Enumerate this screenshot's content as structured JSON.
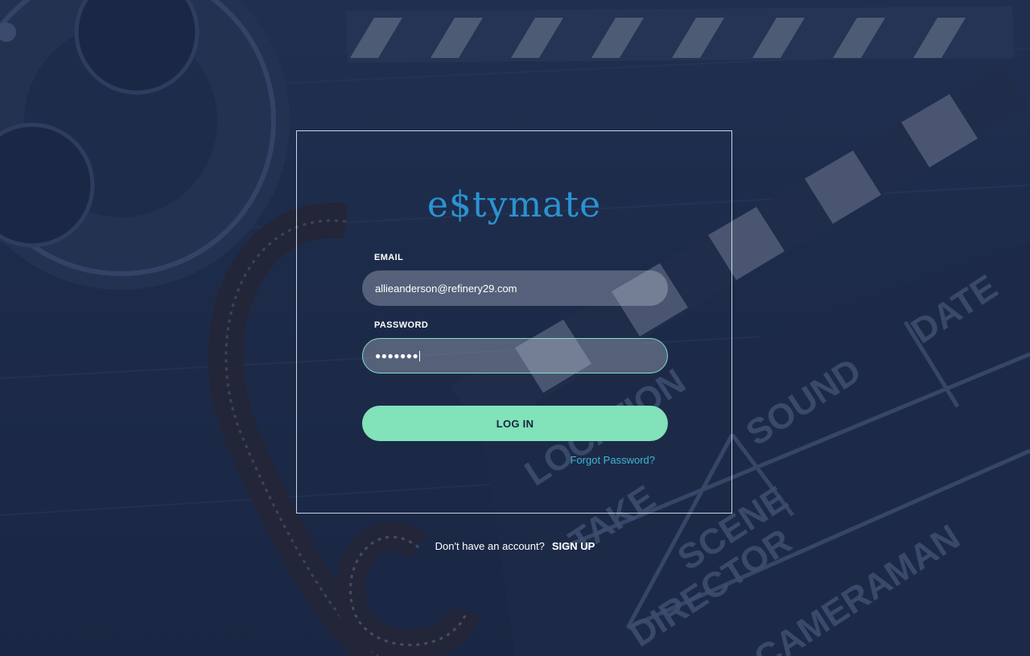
{
  "brand": {
    "logo_text": "e$tymate",
    "logo_color": "#2b93d1"
  },
  "form": {
    "email_label": "EMAIL",
    "email_value": "allieanderson@refinery29.com",
    "password_label": "PASSWORD",
    "password_value": "●●●●●●●",
    "login_label": "LOG IN",
    "forgot_password": "Forgot Password?"
  },
  "signup": {
    "prompt": "Don't have an account?",
    "link_label": "SIGN UP"
  },
  "background": {
    "clapperboard_labels": [
      "LOCATION",
      "SOUND",
      "DATE",
      "TAKE",
      "SCENE",
      "DIRECTOR",
      "CAMERAMAN"
    ]
  },
  "colors": {
    "accent": "#82e2ba",
    "link": "#3fb6d3",
    "focus_border": "#7fe0c2"
  }
}
